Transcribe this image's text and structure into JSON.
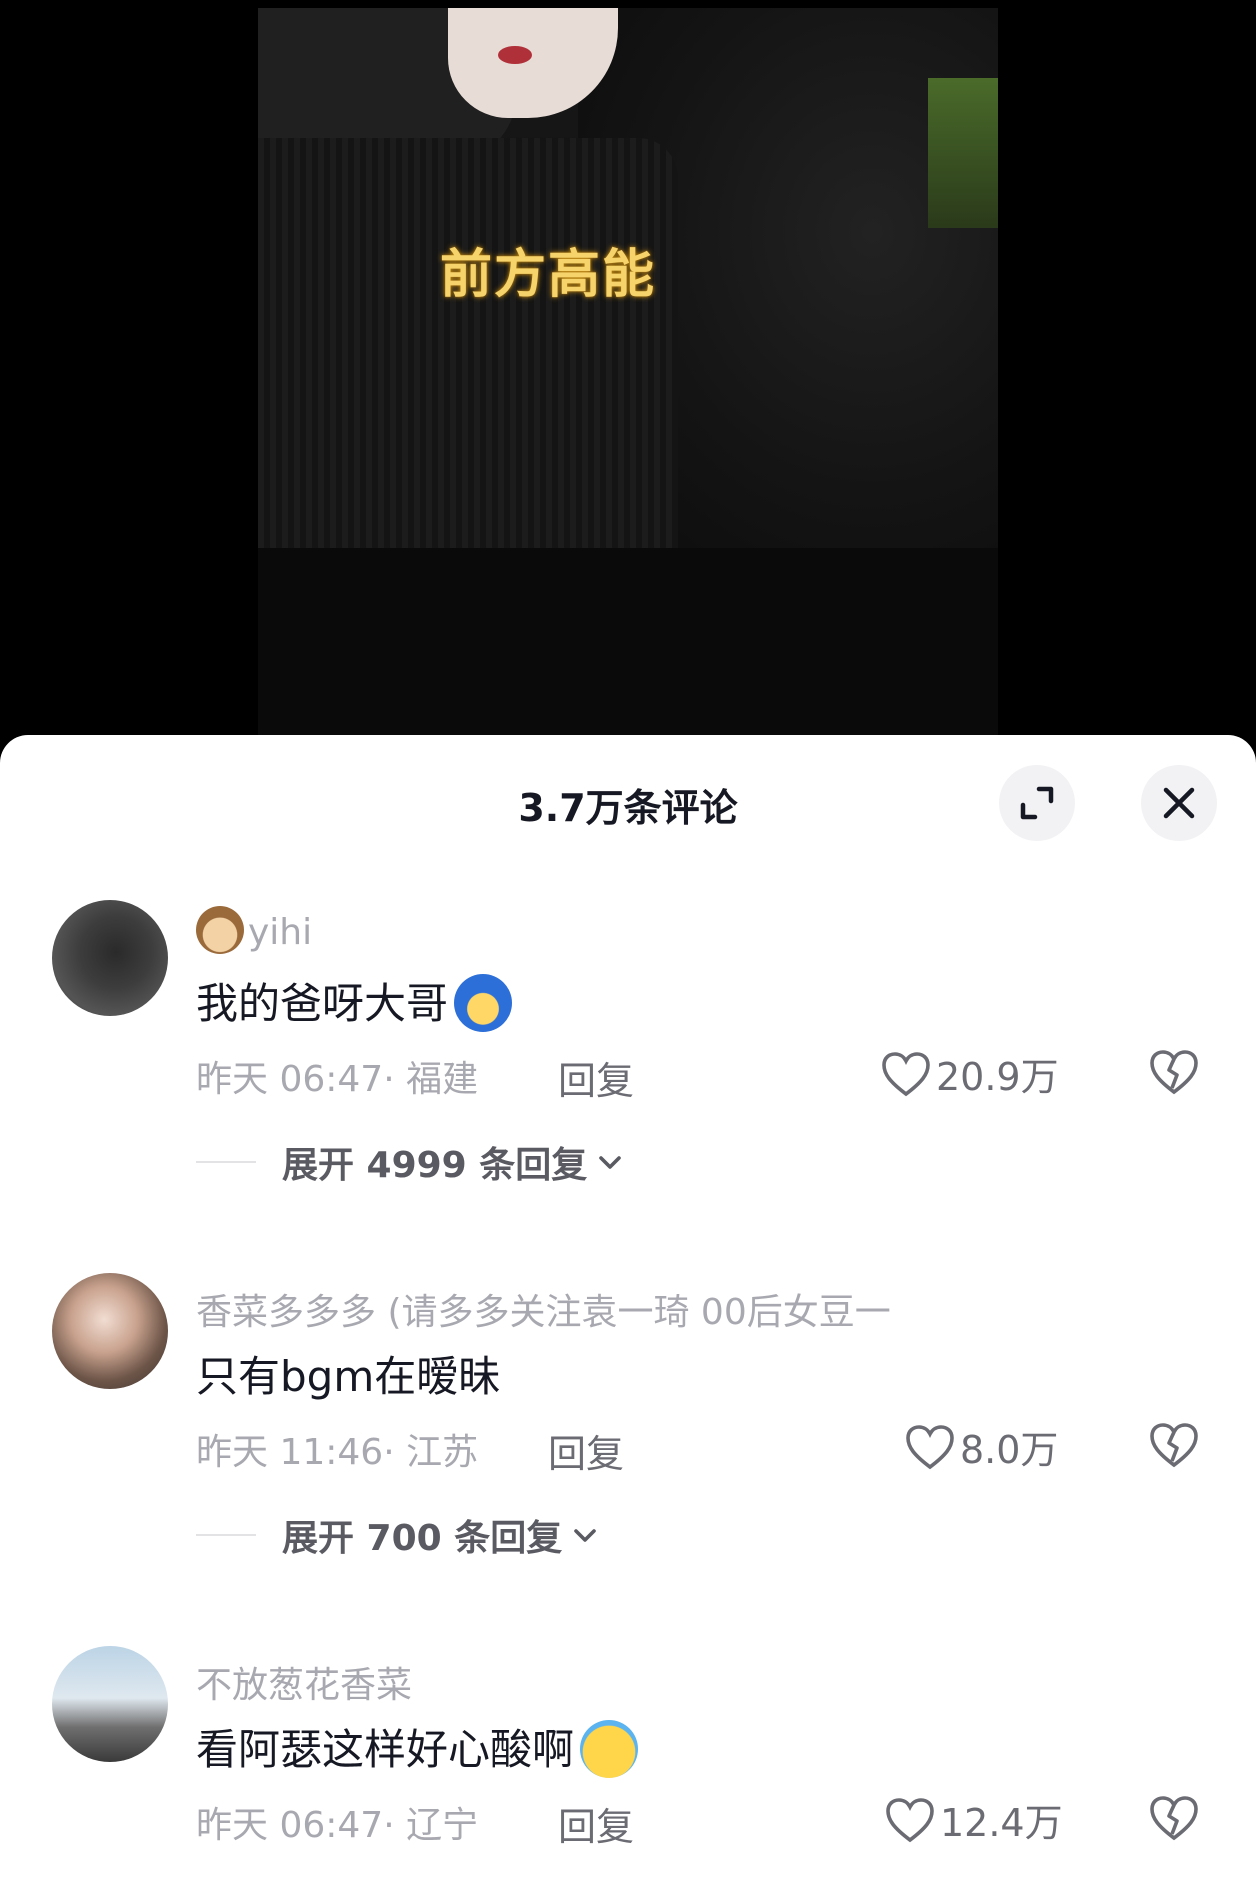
{
  "video": {
    "overlay_text": "前方高能"
  },
  "header": {
    "title": "3.7万条评论",
    "expand_icon": "expand-icon",
    "close_icon": "close-icon"
  },
  "comments": [
    {
      "username": "yihi",
      "username_emoji": "monkey-emoji",
      "text": "我的爸呀大哥",
      "text_emoji": "blue-hair-emoji",
      "time": "昨天 06:47· 福建",
      "reply_label": "回复",
      "likes": "20.9万",
      "expand_label": "展开 4999 条回复"
    },
    {
      "username": "香菜多多多 (请多多关注袁一琦 00后女豆一",
      "text": "只有bgm在暧昧",
      "time": "昨天 11:46· 江苏",
      "reply_label": "回复",
      "likes": "8.0万",
      "expand_label": "展开 700 条回复"
    },
    {
      "username": "不放葱花香菜",
      "text": "看阿瑟这样好心酸啊",
      "text_emoji": "crying-emoji",
      "time": "昨天 06:47· 辽宁",
      "reply_label": "回复",
      "likes": "12.4万"
    }
  ]
}
